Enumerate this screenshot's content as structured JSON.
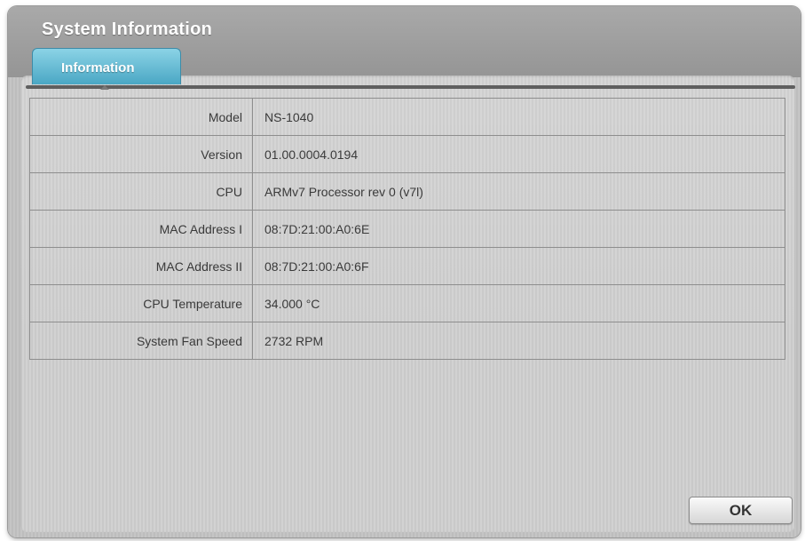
{
  "dialog": {
    "title": "System Information",
    "tabs": [
      {
        "label": "Information",
        "active": true
      }
    ]
  },
  "info_rows": [
    {
      "label": "Model",
      "value": "NS-1040"
    },
    {
      "label": "Version",
      "value": "01.00.0004.0194"
    },
    {
      "label": "CPU",
      "value": "ARMv7 Processor rev 0 (v7l)"
    },
    {
      "label": "MAC Address I",
      "value": "08:7D:21:00:A0:6E"
    },
    {
      "label": "MAC Address II",
      "value": "08:7D:21:00:A0:6F"
    },
    {
      "label": "CPU Temperature",
      "value": "34.000 °C"
    },
    {
      "label": "System Fan Speed",
      "value": "2732 RPM"
    }
  ],
  "footer": {
    "ok_label": "OK"
  },
  "colors": {
    "tab_accent": "#4aa7c4",
    "dialog_background": "#c5c5c5",
    "text": "#3a3a3a"
  }
}
